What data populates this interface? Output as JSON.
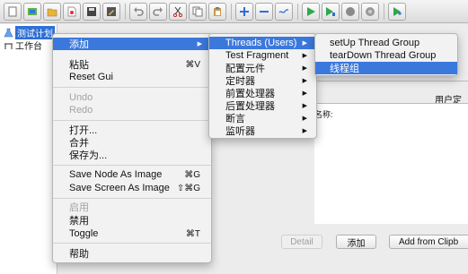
{
  "tree": {
    "root_label": "测试计划",
    "child_label": "工作台"
  },
  "context_menu": {
    "add": "添加",
    "paste": "粘贴",
    "paste_shortcut": "⌘V",
    "reset_gui": "Reset Gui",
    "undo": "Undo",
    "redo": "Redo",
    "open": "打开...",
    "merge": "合并",
    "save_as": "保存为...",
    "save_node_image": "Save Node As Image",
    "save_node_image_shortcut": "⌘G",
    "save_screen_image": "Save Screen As Image",
    "save_screen_image_shortcut": "⇧⌘G",
    "enable": "启用",
    "disable": "禁用",
    "toggle": "Toggle",
    "toggle_shortcut": "⌘T",
    "help": "帮助"
  },
  "add_submenu": {
    "threads": "Threads (Users)",
    "test_fragment": "Test Fragment",
    "config_elements": "配置元件",
    "timer": "定时器",
    "pre_processors": "前置处理器",
    "post_processors": "后置处理器",
    "assertions": "断言",
    "listeners": "监听器"
  },
  "threads_submenu": {
    "setup": "setUp Thread Group",
    "teardown": "tearDown Thread Group",
    "thread_group": "线程组"
  },
  "panel": {
    "user_label": "用户定",
    "name_label": "名称:",
    "detail_button": "Detail",
    "add_button": "添加",
    "add_from_clipboard_button": "Add from Clipb"
  },
  "colors": {
    "highlight": "#3b78dc",
    "tree_selection": "#2f6fd6",
    "run_green": "#2fa84a"
  },
  "toolbar_icons": [
    "new-icon",
    "templates-icon",
    "open-icon",
    "recent-icon",
    "save-icon",
    "save-as-icon",
    "cut-icon",
    "copy-icon",
    "paste-icon",
    "undo-icon",
    "redo-icon",
    "expand-icon",
    "collapse-icon",
    "toggle-icon",
    "start-icon",
    "start-no-pause-icon",
    "stop-icon",
    "shutdown-icon",
    "remote-start-icon"
  ]
}
